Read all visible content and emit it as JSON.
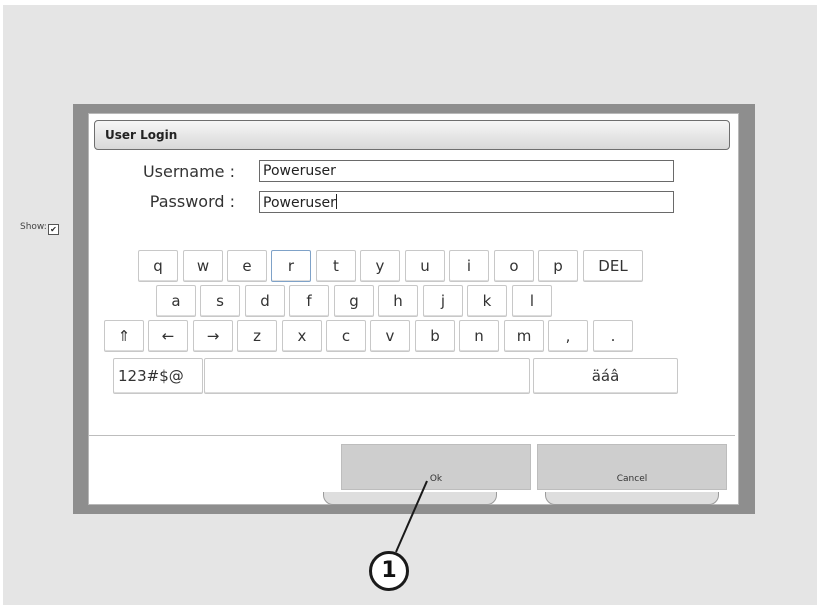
{
  "dialog": {
    "title": "User Login",
    "username_label": "Username :",
    "username_value": "Poweruser",
    "password_label": "Password :",
    "password_value": "Poweruser",
    "show_label": "Show:",
    "show_checked": true,
    "show_check_glyph": "✔"
  },
  "keyboard": {
    "row1": [
      "q",
      "w",
      "e",
      "r",
      "t",
      "y",
      "u",
      "i",
      "o",
      "p",
      "DEL"
    ],
    "row2": [
      "a",
      "s",
      "d",
      "f",
      "g",
      "h",
      "j",
      "k",
      "l"
    ],
    "row3": [
      "⇑",
      "←",
      "→",
      "z",
      "x",
      "c",
      "v",
      "b",
      "n",
      "m",
      ",",
      "."
    ],
    "symbols_label": "123#$@",
    "space_label": "",
    "accents_label": "äáâ"
  },
  "buttons": {
    "ok_label": "Ok",
    "cancel_label": "Cancel"
  },
  "callout": {
    "number": "1"
  }
}
